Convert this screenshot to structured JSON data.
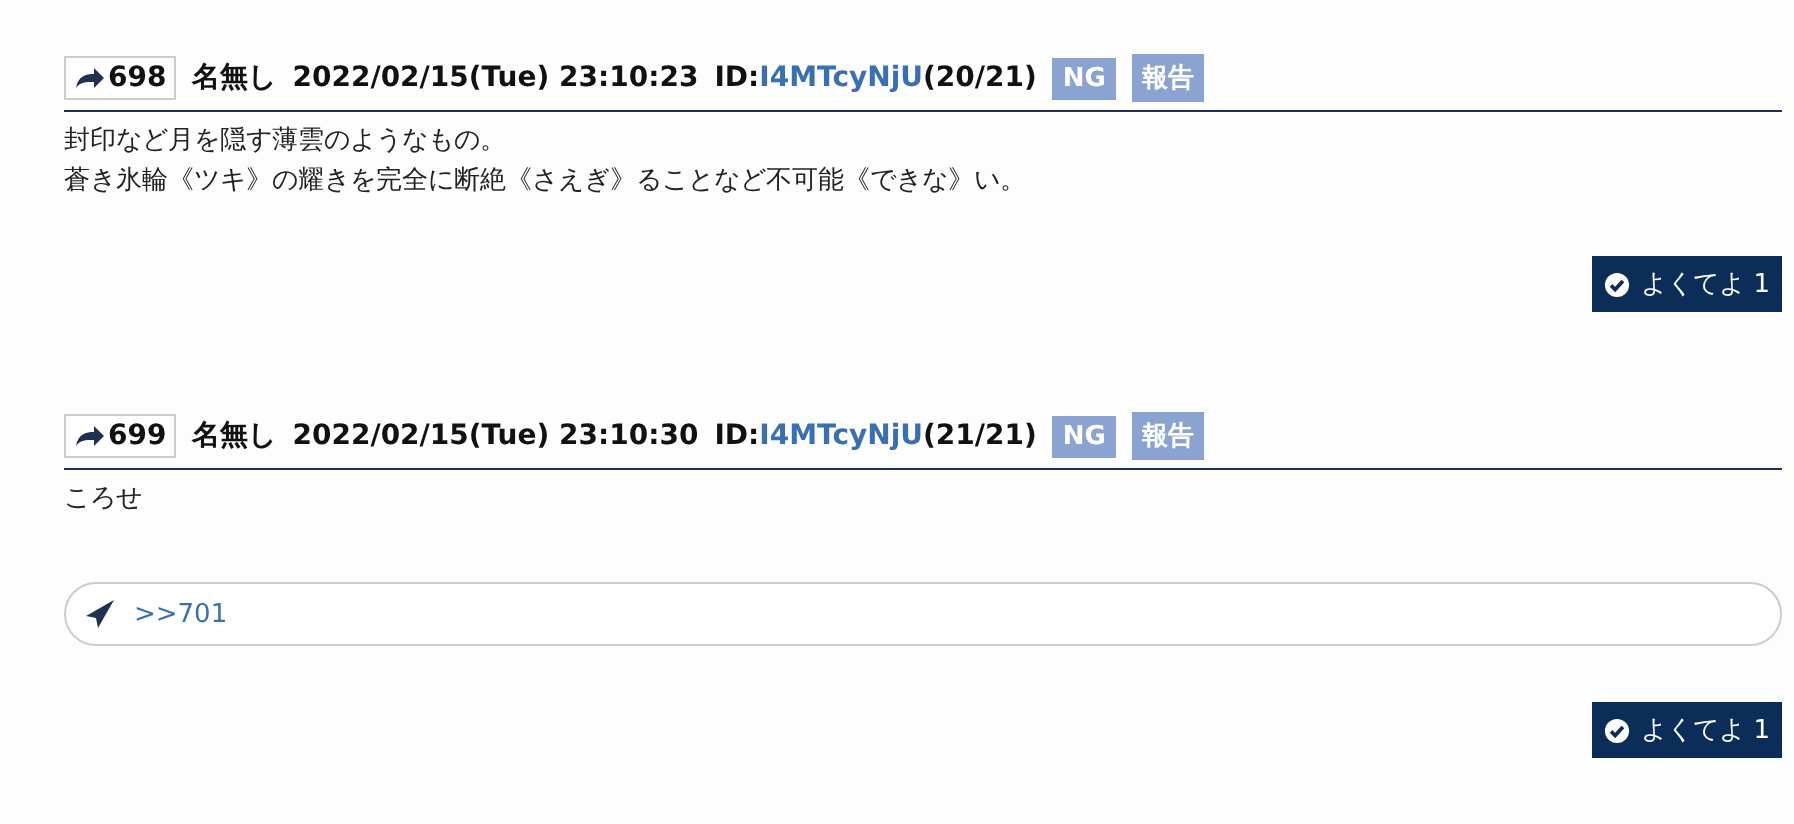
{
  "posts": [
    {
      "number": "698",
      "name": "名無し",
      "datetime": "2022/02/15(Tue) 23:10:23",
      "id_label": "ID:",
      "id": "I4MTcyNjU",
      "id_count": "(20/21)",
      "ng": "NG",
      "report": "報告",
      "body": [
        "封印など月を隠す薄雲のようなもの。",
        "蒼き氷輪《ツキ》の耀きを完全に断絶《さえぎ》ることなど不可能《できな》い。"
      ],
      "like": "よくてよ 1"
    },
    {
      "number": "699",
      "name": "名無し",
      "datetime": "2022/02/15(Tue) 23:10:30",
      "id_label": "ID:",
      "id": "I4MTcyNjU",
      "id_count": "(21/21)",
      "ng": "NG",
      "report": "報告",
      "body": [
        "ころせ"
      ],
      "reply_field": {
        "value": ">>701"
      },
      "like": "よくてよ 1"
    }
  ]
}
